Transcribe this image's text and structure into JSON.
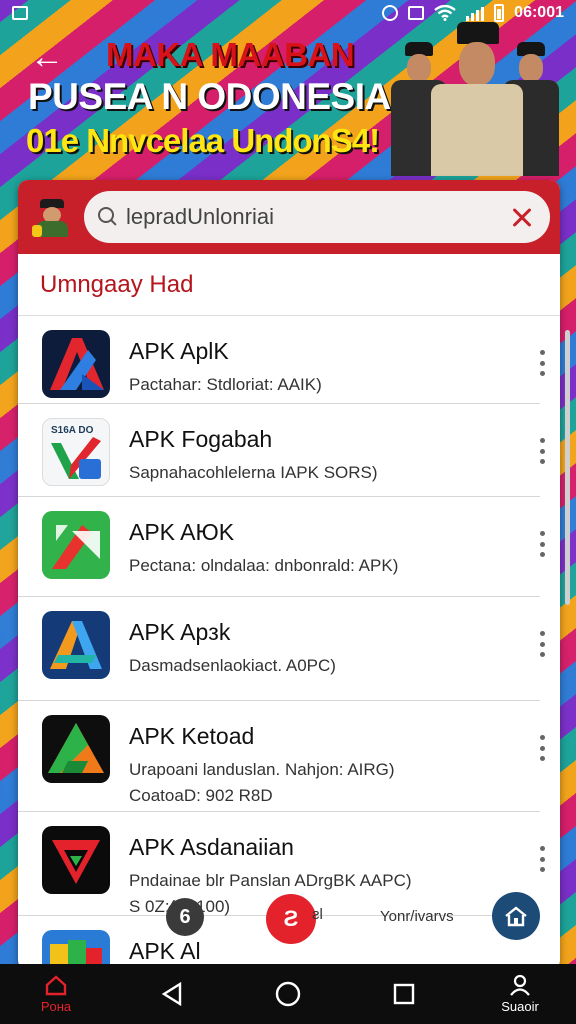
{
  "status_bar": {
    "time": "06:001"
  },
  "banner": {
    "title_line1": "MAKA MAABAN",
    "title_line2": "PUSEA N ODONESIA",
    "title_line3": "01e Nnvcelaa UndonS4!"
  },
  "search": {
    "value": "lepradUnlonriai"
  },
  "section": {
    "title": "Umngaay Had"
  },
  "apps": [
    {
      "title": "APK AplK",
      "subtitle": "Pactahar: Stdloriat: AAIK)",
      "subtitle2": "",
      "icon": "blue-red-a-icon"
    },
    {
      "title": "APK Fogabah",
      "subtitle": "Sapnahacohlelerna IAPK SORS)",
      "subtitle2": "",
      "icon": "red-check-icon",
      "icon_label": "S16A DO"
    },
    {
      "title": "APK AЮK",
      "subtitle": "Pectana: olndalaa: dnbonrald: APK)",
      "subtitle2": "",
      "icon": "green-red-arrow-icon"
    },
    {
      "title": "APK Apзk",
      "subtitle": "Dasmadsenlaokiact. A0PC)",
      "subtitle2": "",
      "icon": "colorful-a-icon"
    },
    {
      "title": "APK Ketoad",
      "subtitle": "Urapoani landuslan. Nahjon: AIRG)",
      "subtitle2": "CoatoaD: 902 R8D",
      "icon": "green-orange-triangle-icon"
    },
    {
      "title": "APK Asdanaiian",
      "subtitle": "Pndainae blr Panslan ADrgBK AAPC)",
      "subtitle2": "S 0Z:(S: 100)",
      "icon": "red-green-v-icon"
    },
    {
      "title": "APK Al",
      "subtitle": "",
      "subtitle2": "",
      "icon": "colorful-stack-icon"
    }
  ],
  "overlay": {
    "left_label": "6",
    "center_symbol": "Ƨ",
    "caption_left": "ƨl",
    "caption_right": "Yonr/ivarvs"
  },
  "nav": {
    "home_label": "Poнa",
    "profile_label": "Suaoir"
  },
  "colors": {
    "brand_red": "#c8202a",
    "fab_red": "#e3222c",
    "fab_navy": "#1d4b78",
    "nav_bg": "#0d0d0d"
  }
}
